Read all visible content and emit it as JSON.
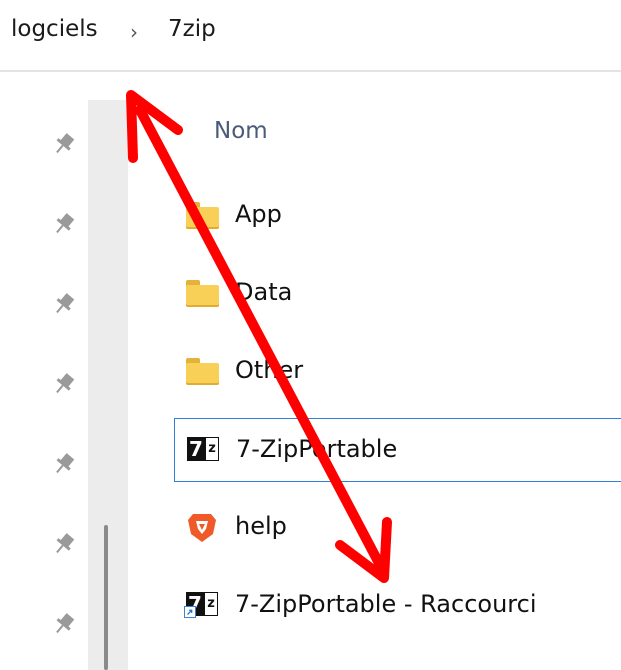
{
  "breadcrumb": {
    "items": [
      "logciels",
      "7zip"
    ],
    "separator": "›"
  },
  "file_list": {
    "column_header": "Nom",
    "rows": [
      {
        "label": "App",
        "icon": "folder-icon"
      },
      {
        "label": "Data",
        "icon": "folder-icon"
      },
      {
        "label": "Other",
        "icon": "folder-icon"
      },
      {
        "label": "7-ZipPortable",
        "icon": "7zip-app-icon",
        "selected": true
      },
      {
        "label": "help",
        "icon": "brave-browser-icon"
      },
      {
        "label": "7-ZipPortable - Raccourci",
        "icon": "7zip-shortcut-icon"
      }
    ]
  },
  "icons": {
    "pin": "pin-icon",
    "sevenzip_left": "7",
    "sevenzip_right": "z"
  },
  "colors": {
    "annotation_arrow": "#ff0000",
    "folder": "#f8cf57",
    "selection_border": "#2f7ed8",
    "brave_orange": "#f05a28"
  }
}
